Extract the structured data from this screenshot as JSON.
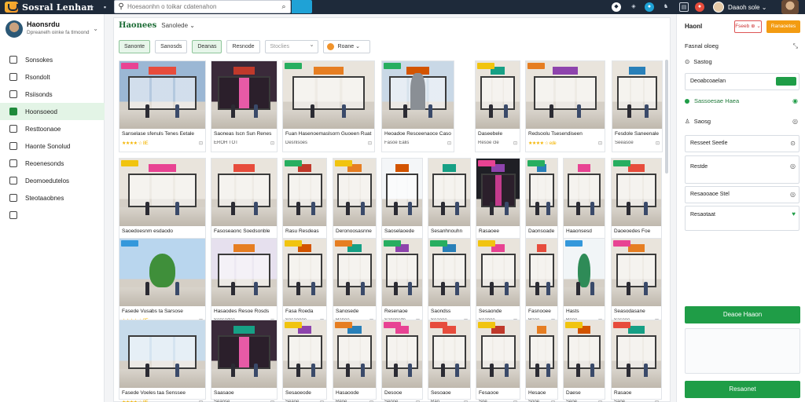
{
  "app": {
    "name": "Sosral Lenhan"
  },
  "search": {
    "placeholder": "Hoesaonhn o toikar cdatenahon"
  },
  "user": {
    "short_name": "Daaoh sole ⌄"
  },
  "profile": {
    "name": "Haonsrdu",
    "subtitle": "Dpreanelh oinke fa tlmoond"
  },
  "nav": [
    {
      "label": "Sonsokes",
      "icon": "grid-icon"
    },
    {
      "label": "Rsondolt",
      "icon": "list-icon"
    },
    {
      "label": "Rsiisonds",
      "icon": "tag-icon"
    },
    {
      "label": "Hoonsoeod",
      "icon": "store-icon",
      "active": true
    },
    {
      "label": "Resttoonaoe",
      "icon": "chart-icon"
    },
    {
      "label": "Haonte Sonolud",
      "icon": "calendar-icon"
    },
    {
      "label": "Reoenesonds",
      "icon": "user-icon"
    },
    {
      "label": "Deomoedutelos",
      "icon": "settings-icon"
    },
    {
      "label": "Steotaaobnes",
      "icon": "doc-icon"
    },
    {
      "label": "",
      "icon": "file-icon"
    }
  ],
  "header": {
    "title": "Haonees",
    "subtitle": "Sanolede ⌄"
  },
  "filters": [
    {
      "label": "Sanonte",
      "on": true
    },
    {
      "label": "Sanosds",
      "on": false
    },
    {
      "label": "Deanas",
      "on": true
    },
    {
      "label": "Resnode",
      "on": false
    },
    {
      "label": "Stoclies",
      "wide": true
    },
    {
      "label": "Roane ⌄",
      "cat": true
    }
  ],
  "cards": [
    {
      "title": "Sanselase sfenuls Tenes Eetale",
      "meta": "★★★★ ☆ 8E",
      "tag": "#e84393",
      "scene": "mall-exterior"
    },
    {
      "title": "Saoneas Iscn Sun Renes",
      "meta": "EROH TOT",
      "tag": "",
      "scene": "pink"
    },
    {
      "title": "Fuan Hasenoemaslsorn Guoeen Ruat",
      "meta": "Desnlsoes",
      "tag": "#27ae60",
      "scene": "shop"
    },
    {
      "title": "Heoadoe Resceenaoce Casoel",
      "meta": "Fasoe  Ealis",
      "tag": "#27ae60",
      "scene": "statue"
    },
    {
      "title": "Daseebele",
      "meta": "Resoe cle",
      "tag": "#f1c40f",
      "scene": "shop"
    },
    {
      "title": "Redsoolu Tsesendiseen",
      "meta": "★★★★ ☆ ede",
      "tag": "#e67e22",
      "scene": "shop"
    },
    {
      "title": "Fesdole Saneenale",
      "meta": "Seeasoe",
      "tag": "",
      "scene": "shop"
    },
    {
      "title": "Saoedoesnm esdaodo",
      "meta": "★★★★ ☆ 8E",
      "tag": "#f1c40f",
      "scene": "shop"
    },
    {
      "title": "Fasoseaonc Soedsonble",
      "meta": "Seacosoua oade",
      "tag": "",
      "scene": "shop"
    },
    {
      "title": "Rasu Resdeas",
      "meta": "Rosccele",
      "tag": "#27ae60",
      "scene": "shop"
    },
    {
      "title": "Deronoosasnne",
      "meta": "Rasonees",
      "tag": "#f1c40f",
      "scene": "shop"
    },
    {
      "title": "Saoselaoede",
      "meta": "Saooe",
      "tag": "",
      "scene": "white"
    },
    {
      "title": "Sesanhnouhn",
      "meta": "Saonesde",
      "tag": "",
      "scene": "shop"
    },
    {
      "title": "Rasaoee",
      "meta": "Hoaoe",
      "tag": "#e84393",
      "scene": "dark"
    },
    {
      "title": "Daonsoade",
      "meta": "Soseooe",
      "tag": "#27ae60",
      "scene": "shop"
    },
    {
      "title": "Haaonsesd",
      "meta": "Faooe",
      "tag": "",
      "scene": "shop"
    },
    {
      "title": "Daoeoedes Foe",
      "meta": "Sacnaose",
      "tag": "#27ae60",
      "scene": "shop"
    },
    {
      "title": "Fasede Vusabs ta Sarsose",
      "meta": "★★★★ ☆ 8E",
      "tag": "#3498db",
      "scene": "garden"
    },
    {
      "title": "Hasaodes Resoe Rosds",
      "meta": "Sensodoe",
      "tag": "",
      "scene": "purple"
    },
    {
      "title": "Fasa Roeda",
      "meta": "Sesaoooe",
      "tag": "#f1c40f",
      "scene": "shop"
    },
    {
      "title": "Sanosede",
      "meta": "Hanoe",
      "tag": "#e67e22",
      "scene": "shop"
    },
    {
      "title": "Resenaoe",
      "meta": "Sanonsde",
      "tag": "#27ae60",
      "scene": "shop"
    },
    {
      "title": "Saondss",
      "meta": "Seaooe",
      "tag": "#27ae60",
      "scene": "shop"
    },
    {
      "title": "Sesaonde",
      "meta": "Seanoe",
      "tag": "#f1c40f",
      "scene": "shop"
    },
    {
      "title": "Fasnooee",
      "meta": "Haoe",
      "tag": "",
      "scene": "shop"
    },
    {
      "title": "Hasts",
      "meta": "Reoe",
      "tag": "#3498db",
      "scene": "plant"
    },
    {
      "title": "Seasodasane",
      "meta": "Sasooe",
      "tag": "#e84393",
      "scene": "shop"
    },
    {
      "title": "Fasede Voeles taa Senssee",
      "meta": "★★★★ ☆ 8E",
      "tag": "",
      "scene": "street"
    },
    {
      "title": "Saasaoe",
      "meta": "Seaose",
      "tag": "",
      "scene": "pink"
    },
    {
      "title": "Sesaoeode",
      "meta": "Seaoe",
      "tag": "#f1c40f",
      "scene": "shop"
    },
    {
      "title": "Hasaoode",
      "meta": "Reoe",
      "tag": "#e67e22",
      "scene": "shop"
    },
    {
      "title": "Desooe",
      "meta": "Seooe",
      "tag": "#e84393",
      "scene": "shop"
    },
    {
      "title": "Sesoaoe",
      "meta": "Rao",
      "tag": "#e74c3c",
      "scene": "shop"
    },
    {
      "title": "Fesaooe",
      "meta": "Soe",
      "tag": "#f1c40f",
      "scene": "shop"
    },
    {
      "title": "Hesaoe",
      "meta": "Sooe",
      "tag": "",
      "scene": "shop"
    },
    {
      "title": "Daese",
      "meta": "Seoe",
      "tag": "#f1c40f",
      "scene": "shop"
    },
    {
      "title": "Rasaoe",
      "meta": "Saoe",
      "tag": "#e74c3c",
      "scene": "shop"
    }
  ],
  "panel": {
    "title": "Haonl",
    "outline_btn": "Fseeb ⊕ ⌄",
    "primary_btn": "Ranaoetes",
    "section1": "Fasnal oloeg",
    "section2": "Sastog",
    "box1": "Deoabcoaelan",
    "row_toggle": "Sassoesae Haea",
    "row_setting": "Saosg",
    "box2": "Resseet Seetle",
    "box3": "Restde",
    "box4": "Resaooaoe Stel",
    "box5": "Resaotaat",
    "btn_main": "Deaoe Haaon",
    "btn_bottom": "Resaonet"
  },
  "colors": {
    "accent": "#1f9d47",
    "topbar": "#1e2a3a",
    "orange": "#f39c12",
    "search_btn": "#1fa2d6"
  }
}
